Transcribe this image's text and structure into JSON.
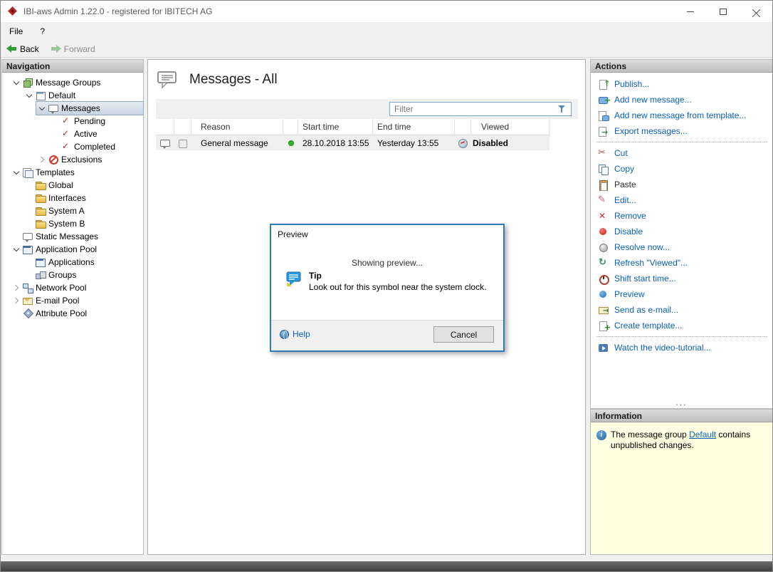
{
  "window": {
    "title": "IBI-aws Admin 1.22.0 - registered for IBITECH AG"
  },
  "menu": {
    "file": "File",
    "help": "?"
  },
  "toolbar": {
    "back_label": "Back",
    "forward_label": "Forward"
  },
  "navigation": {
    "header": "Navigation",
    "items": [
      {
        "label": "Message Groups"
      },
      {
        "label": "Default"
      },
      {
        "label": "Messages"
      },
      {
        "label": "Pending"
      },
      {
        "label": "Active"
      },
      {
        "label": "Completed"
      },
      {
        "label": "Exclusions"
      },
      {
        "label": "Templates"
      },
      {
        "label": "Global"
      },
      {
        "label": "Interfaces"
      },
      {
        "label": "System A"
      },
      {
        "label": "System B"
      },
      {
        "label": "Static Messages"
      },
      {
        "label": "Application Pool"
      },
      {
        "label": "Applications"
      },
      {
        "label": "Groups"
      },
      {
        "label": "Network Pool"
      },
      {
        "label": "E-mail Pool"
      },
      {
        "label": "Attribute Pool"
      }
    ],
    "selected": "Messages"
  },
  "content": {
    "title": "Messages - All",
    "filter_placeholder": "Filter",
    "table": {
      "columns": [
        "Reason",
        "Start time",
        "End time",
        "Viewed"
      ],
      "rows": [
        {
          "reason": "General message",
          "start_time": "28.10.2018 13:55",
          "end_time": "Yesterday 13:55",
          "viewed": "Disabled"
        }
      ]
    }
  },
  "dialog": {
    "title": "Preview",
    "message": "Showing preview...",
    "tip_title": "Tip",
    "tip_text": "Look out for this symbol near the system clock.",
    "help_label": "Help",
    "cancel_label": "Cancel"
  },
  "actions": {
    "header": "Actions",
    "items": [
      {
        "label": "Publish..."
      },
      {
        "label": "Add new message..."
      },
      {
        "label": "Add new message from template..."
      },
      {
        "label": "Export messages..."
      },
      {
        "label": "Cut"
      },
      {
        "label": "Copy"
      },
      {
        "label": "Paste",
        "disabled": true
      },
      {
        "label": "Edit..."
      },
      {
        "label": "Remove"
      },
      {
        "label": "Disable"
      },
      {
        "label": "Resolve now..."
      },
      {
        "label": "Refresh \"Viewed\"..."
      },
      {
        "label": "Shift start time..."
      },
      {
        "label": "Preview"
      },
      {
        "label": "Send as e-mail..."
      },
      {
        "label": "Create template..."
      },
      {
        "label": "Watch the video-tutorial..."
      }
    ],
    "more": "..."
  },
  "information": {
    "header": "Information",
    "text_before": "The message group ",
    "link_text": "Default",
    "text_after": " contains unpublished changes."
  },
  "colors": {
    "link_blue": "#0a60b6",
    "dialog_border": "#2b7cb8",
    "info_bg": "#ffffe1",
    "status_green_dot": "#2fb524",
    "disable_red": "#c01818",
    "selected_tree_bg": "#c8d4e2"
  },
  "icons": {
    "filter": "funnel-icon",
    "row_type": "message-bubble-icon",
    "viewed_status": "globe-icon",
    "info": "info-circle-icon",
    "help": "globe-help-icon",
    "tip": "tip-bubble-icon"
  }
}
